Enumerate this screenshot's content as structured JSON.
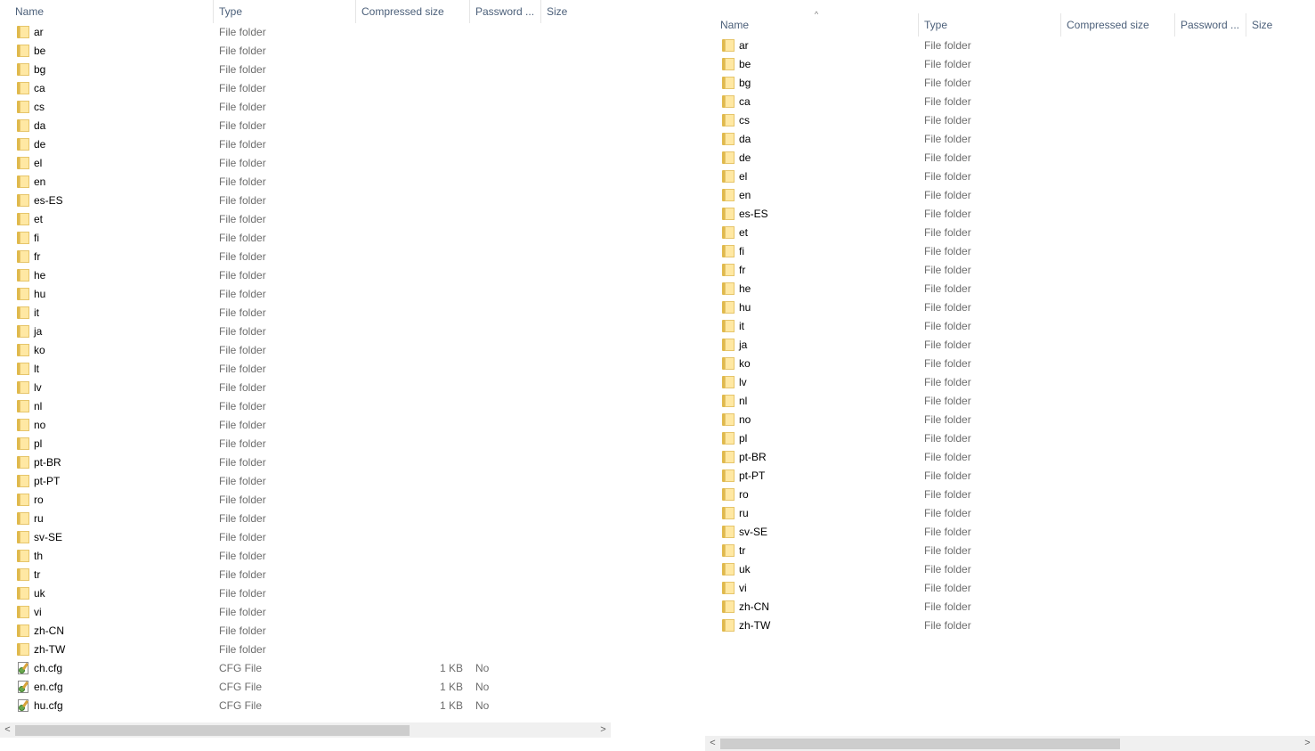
{
  "left_pane": {
    "columns": {
      "name": "Name",
      "type": "Type",
      "compressed_size": "Compressed size",
      "password": "Password ...",
      "size": "Size"
    },
    "sort_arrow": "^",
    "rows": [
      {
        "name": "ar",
        "type": "File folder"
      },
      {
        "name": "be",
        "type": "File folder"
      },
      {
        "name": "bg",
        "type": "File folder"
      },
      {
        "name": "ca",
        "type": "File folder"
      },
      {
        "name": "cs",
        "type": "File folder"
      },
      {
        "name": "da",
        "type": "File folder"
      },
      {
        "name": "de",
        "type": "File folder"
      },
      {
        "name": "el",
        "type": "File folder"
      },
      {
        "name": "en",
        "type": "File folder"
      },
      {
        "name": "es-ES",
        "type": "File folder"
      },
      {
        "name": "et",
        "type": "File folder"
      },
      {
        "name": "fi",
        "type": "File folder"
      },
      {
        "name": "fr",
        "type": "File folder"
      },
      {
        "name": "he",
        "type": "File folder"
      },
      {
        "name": "hu",
        "type": "File folder"
      },
      {
        "name": "it",
        "type": "File folder"
      },
      {
        "name": "ja",
        "type": "File folder"
      },
      {
        "name": "ko",
        "type": "File folder"
      },
      {
        "name": "lt",
        "type": "File folder"
      },
      {
        "name": "lv",
        "type": "File folder"
      },
      {
        "name": "nl",
        "type": "File folder"
      },
      {
        "name": "no",
        "type": "File folder"
      },
      {
        "name": "pl",
        "type": "File folder"
      },
      {
        "name": "pt-BR",
        "type": "File folder"
      },
      {
        "name": "pt-PT",
        "type": "File folder"
      },
      {
        "name": "ro",
        "type": "File folder"
      },
      {
        "name": "ru",
        "type": "File folder"
      },
      {
        "name": "sv-SE",
        "type": "File folder"
      },
      {
        "name": "th",
        "type": "File folder"
      },
      {
        "name": "tr",
        "type": "File folder"
      },
      {
        "name": "uk",
        "type": "File folder"
      },
      {
        "name": "vi",
        "type": "File folder"
      },
      {
        "name": "zh-CN",
        "type": "File folder"
      },
      {
        "name": "zh-TW",
        "type": "File folder"
      },
      {
        "name": "ch.cfg",
        "type": "CFG File",
        "compressed_size": "1 KB",
        "password": "No",
        "icon": "cfg-file-icon"
      },
      {
        "name": "en.cfg",
        "type": "CFG File",
        "compressed_size": "1 KB",
        "password": "No",
        "icon": "cfg-file-icon"
      },
      {
        "name": "hu.cfg",
        "type": "CFG File",
        "compressed_size": "1 KB",
        "password": "No",
        "icon": "cfg-file-icon"
      }
    ],
    "scrollbar": {
      "left_arrow": "<",
      "right_arrow": ">",
      "thumb_fraction": 0.68
    }
  },
  "right_pane": {
    "columns": {
      "name": "Name",
      "type": "Type",
      "compressed_size": "Compressed size",
      "password": "Password ...",
      "size": "Size"
    },
    "sort_arrow": "^",
    "rows": [
      {
        "name": "ar",
        "type": "File folder"
      },
      {
        "name": "be",
        "type": "File folder"
      },
      {
        "name": "bg",
        "type": "File folder"
      },
      {
        "name": "ca",
        "type": "File folder"
      },
      {
        "name": "cs",
        "type": "File folder"
      },
      {
        "name": "da",
        "type": "File folder"
      },
      {
        "name": "de",
        "type": "File folder"
      },
      {
        "name": "el",
        "type": "File folder"
      },
      {
        "name": "en",
        "type": "File folder"
      },
      {
        "name": "es-ES",
        "type": "File folder"
      },
      {
        "name": "et",
        "type": "File folder"
      },
      {
        "name": "fi",
        "type": "File folder"
      },
      {
        "name": "fr",
        "type": "File folder"
      },
      {
        "name": "he",
        "type": "File folder"
      },
      {
        "name": "hu",
        "type": "File folder"
      },
      {
        "name": "it",
        "type": "File folder"
      },
      {
        "name": "ja",
        "type": "File folder"
      },
      {
        "name": "ko",
        "type": "File folder"
      },
      {
        "name": "lv",
        "type": "File folder"
      },
      {
        "name": "nl",
        "type": "File folder"
      },
      {
        "name": "no",
        "type": "File folder"
      },
      {
        "name": "pl",
        "type": "File folder"
      },
      {
        "name": "pt-BR",
        "type": "File folder"
      },
      {
        "name": "pt-PT",
        "type": "File folder"
      },
      {
        "name": "ro",
        "type": "File folder"
      },
      {
        "name": "ru",
        "type": "File folder"
      },
      {
        "name": "sv-SE",
        "type": "File folder"
      },
      {
        "name": "tr",
        "type": "File folder"
      },
      {
        "name": "uk",
        "type": "File folder"
      },
      {
        "name": "vi",
        "type": "File folder"
      },
      {
        "name": "zh-CN",
        "type": "File folder"
      },
      {
        "name": "zh-TW",
        "type": "File folder"
      }
    ],
    "scrollbar": {
      "left_arrow": "<",
      "right_arrow": ">",
      "thumb_fraction": 0.69
    }
  },
  "icon_colors": {
    "folder_body": "#ffe8a3",
    "folder_tab": "#e0b94c",
    "header_text": "#4c607a",
    "secondary_text": "#6d6d6d"
  }
}
